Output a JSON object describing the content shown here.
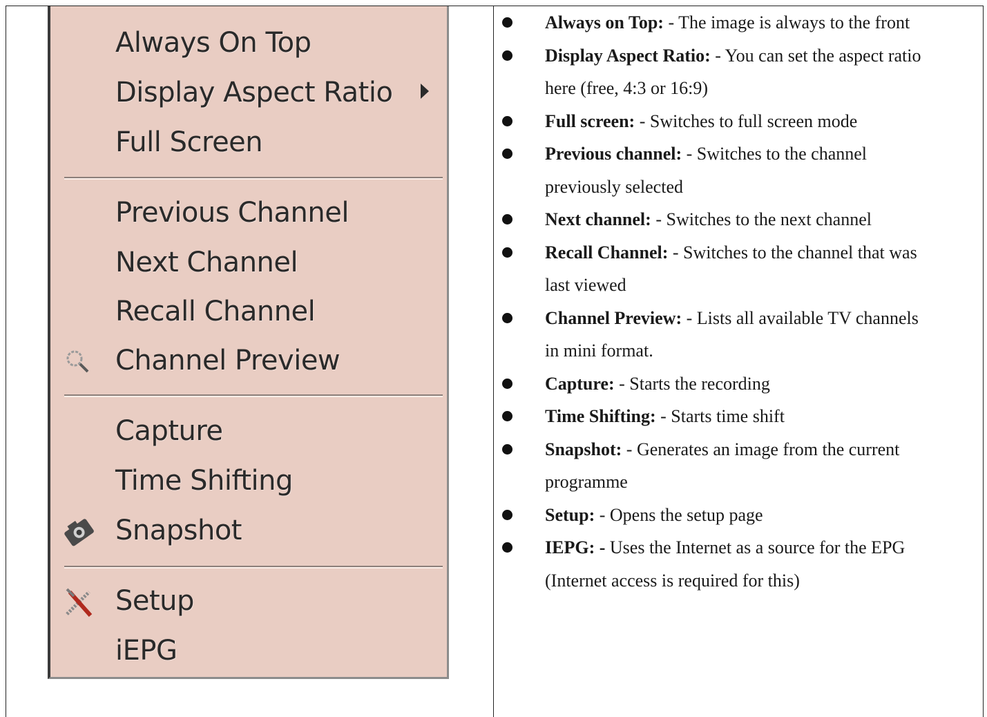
{
  "menu": {
    "items": [
      {
        "label": "Always On Top"
      },
      {
        "label": "Display Aspect Ratio",
        "submenu_icon": "triangle-right-icon"
      },
      {
        "label": "Full Screen"
      },
      {
        "label": "Previous Channel"
      },
      {
        "label": "Next Channel"
      },
      {
        "label": "Recall Channel"
      },
      {
        "label": "Channel Preview",
        "icon": "magnifier-icon"
      },
      {
        "label": "Capture"
      },
      {
        "label": "Time Shifting"
      },
      {
        "label": "Snapshot",
        "icon": "camera-icon"
      },
      {
        "label": "Setup",
        "icon": "tools-icon"
      },
      {
        "label": "iEPG"
      }
    ],
    "background_color": "#e9cdc3"
  },
  "descriptions": [
    {
      "term": "Always on Top:",
      "text": " - The image is always to the front",
      "continuation": ""
    },
    {
      "term": "Display Aspect Ratio:",
      "text": " - You can set the aspect ratio",
      "continuation": "here (free, 4:3 or 16:9)"
    },
    {
      "term": "Full screen:",
      "text": " - Switches to full screen mode",
      "continuation": ""
    },
    {
      "term": "Previous channel:",
      "text": " - Switches to the channel",
      "continuation": "previously selected"
    },
    {
      "term": "Next channel:",
      "text": " - Switches to the next channel",
      "continuation": ""
    },
    {
      "term": "Recall Channel:",
      "text": " - Switches to the channel that was",
      "continuation": "last viewed"
    },
    {
      "term": "Channel Preview:",
      "text": " - Lists all available TV channels",
      "continuation": "in mini format."
    },
    {
      "term": "Capture:",
      "text": " - Starts the recording",
      "continuation": ""
    },
    {
      "term": "Time Shifting:",
      "text": " - Starts time shift",
      "continuation": ""
    },
    {
      "term": "Snapshot:",
      "text": " - Generates an image from the current",
      "continuation": "programme"
    },
    {
      "term": "Setup:",
      "text": " - Opens the setup page",
      "continuation": ""
    },
    {
      "term": "IEPG: -",
      "text": " Uses the Internet as a source for the EPG",
      "continuation": "(Internet access is required for this)"
    }
  ]
}
